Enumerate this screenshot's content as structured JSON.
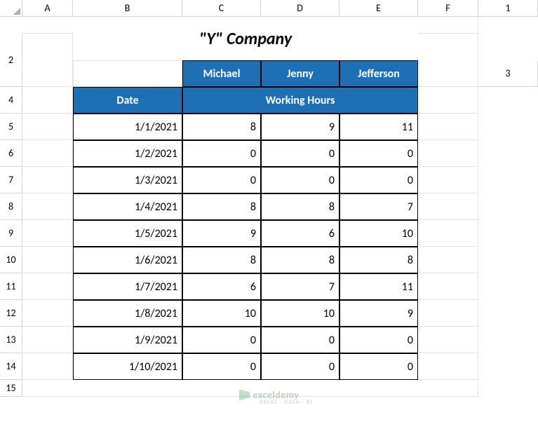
{
  "columns": [
    "A",
    "B",
    "C",
    "D",
    "E",
    "F"
  ],
  "rows": [
    "1",
    "2",
    "3",
    "4",
    "5",
    "6",
    "7",
    "8",
    "9",
    "10",
    "11",
    "12",
    "13",
    "14",
    "15"
  ],
  "title": "\"Y\" Company",
  "headers": {
    "date": "Date",
    "working_hours": "Working Hours",
    "names": [
      "Michael",
      "Jenny",
      "Jefferson"
    ]
  },
  "chart_data": {
    "type": "table",
    "title": "\"Y\" Company",
    "columns": [
      "Date",
      "Michael",
      "Jenny",
      "Jefferson"
    ],
    "rows": [
      {
        "date": "1/1/2021",
        "values": [
          8,
          9,
          11
        ]
      },
      {
        "date": "1/2/2021",
        "values": [
          0,
          0,
          0
        ]
      },
      {
        "date": "1/3/2021",
        "values": [
          0,
          0,
          0
        ]
      },
      {
        "date": "1/4/2021",
        "values": [
          8,
          8,
          7
        ]
      },
      {
        "date": "1/5/2021",
        "values": [
          9,
          6,
          10
        ]
      },
      {
        "date": "1/6/2021",
        "values": [
          8,
          8,
          8
        ]
      },
      {
        "date": "1/7/2021",
        "values": [
          6,
          7,
          11
        ]
      },
      {
        "date": "1/8/2021",
        "values": [
          10,
          10,
          9
        ]
      },
      {
        "date": "1/9/2021",
        "values": [
          0,
          0,
          0
        ]
      },
      {
        "date": "1/10/2021",
        "values": [
          0,
          0,
          0
        ]
      }
    ]
  },
  "watermark": {
    "part1": "excel",
    "part2": "demy",
    "sub": "EXCEL · DATA · BI"
  }
}
